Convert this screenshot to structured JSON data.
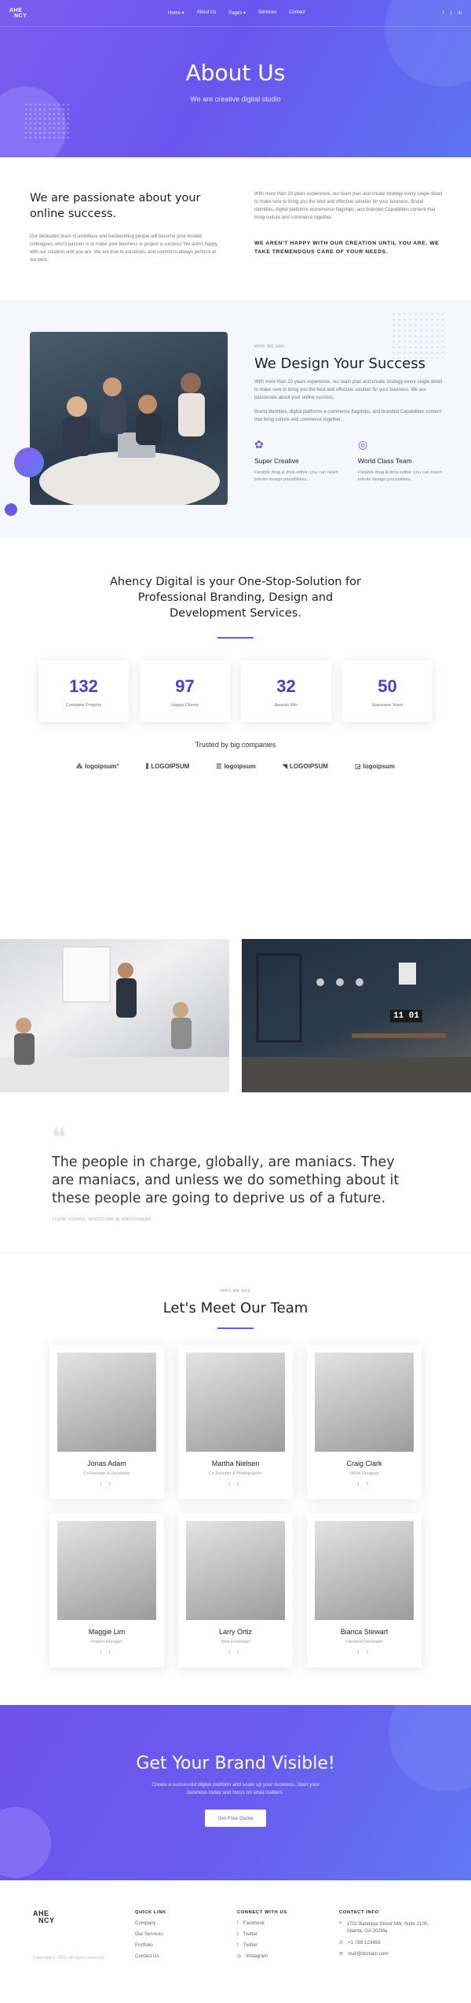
{
  "nav": {
    "logo_top": "AHE",
    "logo_bottom": "NCY",
    "links": [
      "Home ▾",
      "About Us",
      "Pages ▾",
      "Services",
      "Contact"
    ],
    "social": [
      "f",
      "t",
      "in"
    ]
  },
  "hero": {
    "title": "About Us",
    "subtitle": "We are creative digital studio"
  },
  "intro": {
    "heading": "We are passionate about your online success.",
    "left_text": "Our dedicated team of ambitious and hardworking people will become your trusted colleagues, who's passion is to make your business or project a success! We aren't happy with our creation until you are. We are true to ourselves, and commit to always perform at our best.",
    "right_text": "With more than 10 years experience, our team plan and create strategy every single detail to make sure to bring you the best and effective solution for your business. Brand identities, digital platforms ecommerce flagships, and branded Capabilities content that bring culture and commerce together.",
    "caption": "WE AREN'T HAPPY WITH OUR CREATION UNTIL YOU ARE. WE TAKE TREMENDOUS CARE OF YOUR NEEDS."
  },
  "design": {
    "eyebrow": "WHO WE ARE",
    "heading": "We Design Your Success",
    "p1": "With more than 10 years experience, our team plan and create strategy every single detail to make sure to bring you the best and effective solution for your business. We are passionate about your online success.",
    "p2": "Brand identities, digital platforms e-commerce flagships, and branded Capabilities content that bring culture and commerce together.",
    "features": [
      {
        "icon": "✿",
        "title": "Super Creative",
        "text": "Flexible drag & drop editor, you can reach infinite design possibilities."
      },
      {
        "icon": "◎",
        "title": "World Class Team",
        "text": "Flexible drag & drop editor, you can reach infinite design possibilities."
      }
    ]
  },
  "onestop": {
    "heading": "Ahency Digital is your One-Stop-Solution for Professional Branding, Design and Development Services.",
    "stats": [
      {
        "value": "132",
        "label": "Complete Projects"
      },
      {
        "value": "97",
        "label": "Happy Clients"
      },
      {
        "value": "32",
        "label": "Awards Win"
      },
      {
        "value": "50",
        "label": "Awesome Team"
      }
    ],
    "trusted": "Trusted by big companies",
    "logos": [
      {
        "icon": "⁂",
        "text": "logoipsum°"
      },
      {
        "icon": "⫼",
        "text": "LOGOIPSUM"
      },
      {
        "icon": "☰",
        "text": "logoipsum"
      },
      {
        "icon": "◥",
        "text": "LOGOIPSUM"
      },
      {
        "icon": "◲",
        "text": "logoipsum"
      }
    ],
    "clock": "11 01"
  },
  "quote": {
    "mark": "❝",
    "text": "The people in charge, globally, are maniacs. They are maniacs, and unless we do something about it these people are going to deprive us of a future.",
    "author": "THOM YORKE, MUSICIAN @ RADIOHEAD"
  },
  "team": {
    "eyebrow": "WHO WE ARE",
    "heading": "Let's Meet Our Team",
    "members": [
      {
        "name": "Jonas Adam",
        "role": "Co-Founder & Developer"
      },
      {
        "name": "Martha Nielsen",
        "role": "Co-Founder & Photographer"
      },
      {
        "name": "Craig Clark",
        "role": "UI/UX Designer"
      },
      {
        "name": "Maggie Lim",
        "role": "Project Manager"
      },
      {
        "name": "Larry Ortiz",
        "role": "Web Developer"
      },
      {
        "name": "Bianca Stewart",
        "role": "Frontend Developer"
      }
    ],
    "social": "t f"
  },
  "cta": {
    "heading": "Get Your Brand Visible!",
    "text": "Create a successful digital platform and scale up your business. Start your business today and focus on what matters.",
    "button": "Get Free Quote"
  },
  "footer": {
    "logo_top": "AHE",
    "logo_bottom": "NCY",
    "copyright": "Copyright © 2020. All rights reserved.",
    "quick_title": "QUICK LINK",
    "quick": [
      "Company",
      "Our Services",
      "Portfolio",
      "Contact Us"
    ],
    "connect_title": "CONNECT WITH US",
    "connect": [
      {
        "icon": "f",
        "label": "Facebook"
      },
      {
        "icon": "t",
        "label": "Twitter"
      },
      {
        "icon": "t",
        "label": "Twitter"
      },
      {
        "icon": "◎",
        "label": "Instagram"
      }
    ],
    "contact_title": "CONTACT INFO",
    "contact": [
      {
        "icon": "⌖",
        "label": "1752 Bandaya Street NW, Suite 2100, Atlanta, GA 302Ma"
      },
      {
        "icon": "✆",
        "label": "+1 789 123456"
      },
      {
        "icon": "✉",
        "label": "mail@domain.com"
      }
    ]
  }
}
